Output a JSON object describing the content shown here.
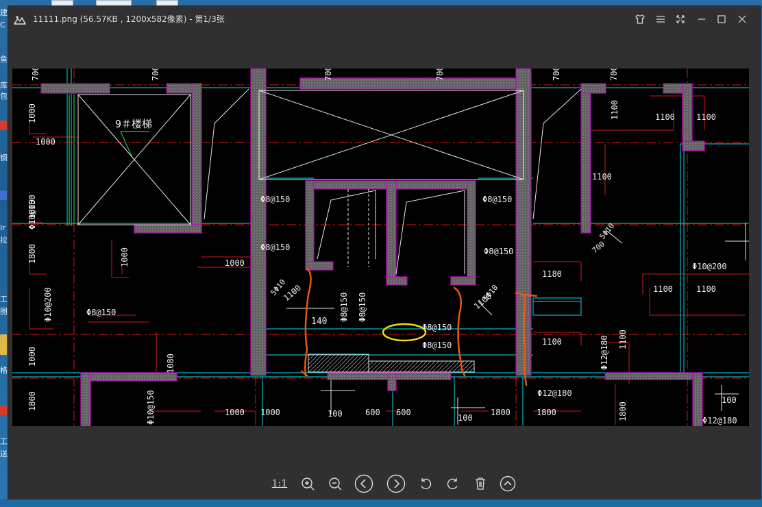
{
  "window": {
    "title": "11111.png (56.57KB , 1200x582像素) - 第1/3张"
  },
  "desktop_fragments": [
    "建",
    "C",
    "鱼",
    "库",
    "包",
    "钢",
    "Ir",
    "拉",
    "工",
    "图",
    "格",
    "工",
    "送"
  ],
  "colors": {
    "window_bg": "#303030",
    "cad_wall_outline": "#c000c0",
    "cad_grid_red": "#e01a1a",
    "cad_line_cyan": "#00c0c0",
    "annotation_orange": "#e85a10",
    "annotation_yellow": "#f0e000"
  },
  "drawing": {
    "stair_label": "9＃楼梯",
    "dimensions": [
      "700",
      "700",
      "700",
      "700",
      "700",
      "700",
      "700",
      "1000",
      "1000",
      "1000",
      "1000",
      "1000",
      "1000",
      "1000",
      "1000",
      "1100",
      "1100",
      "1100",
      "1100",
      "1100",
      "1100",
      "1100",
      "1100",
      "1100",
      "1100",
      "1180",
      "140",
      "100",
      "100",
      "100",
      "600",
      "600",
      "1800",
      "1800",
      "1800",
      "1800",
      "1800",
      "1080"
    ],
    "rebar_labels": [
      "Φ8@150",
      "Φ8@150",
      "Φ8@150",
      "Φ8@150",
      "Φ8@150",
      "Φ8@150",
      "Φ8@150",
      "Φ8@150",
      "Φ8@150",
      "Φ10@200",
      "Φ10@200",
      "Φ10@150",
      "Φ10@150",
      "Φ12@180",
      "Φ12@180",
      "Φ12@180",
      "5Φ10",
      "5Φ10",
      "5Φ10"
    ]
  },
  "bottom_toolbar": {
    "ratio_label": "1:1"
  }
}
